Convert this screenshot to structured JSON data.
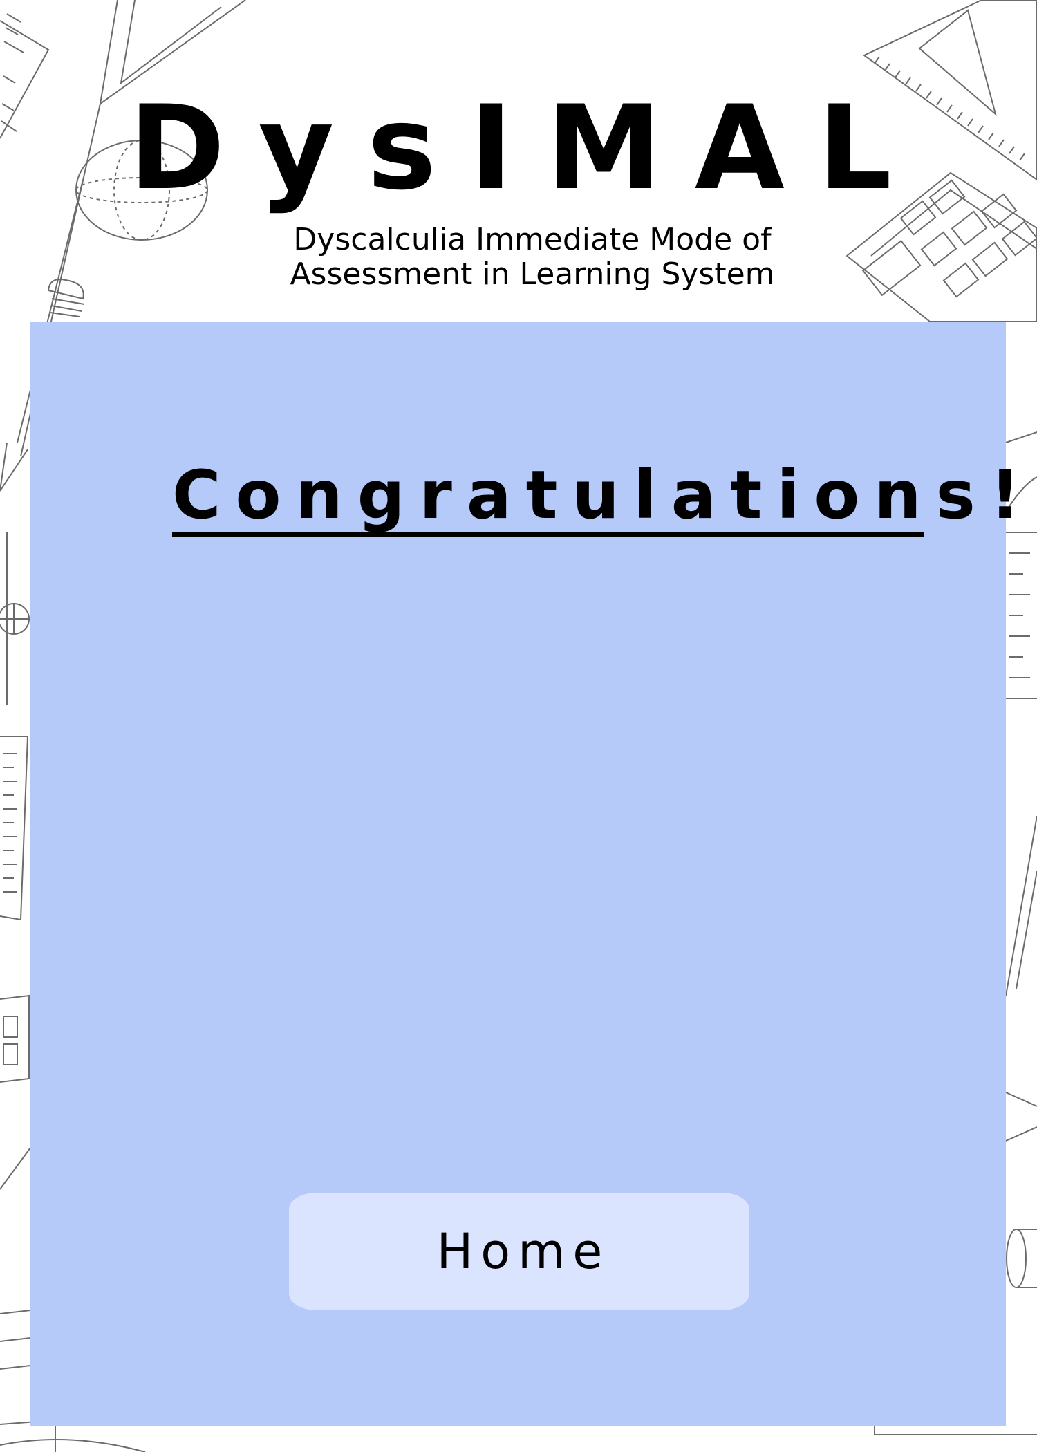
{
  "header": {
    "title": "DysIMAL",
    "subtitle_line1": "Dyscalculia Immediate Mode of",
    "subtitle_line2": "Assessment in Learning System"
  },
  "card": {
    "heading": "Congratulations!",
    "home_button_label": "Home"
  },
  "colors": {
    "card_background": "#b5caf9",
    "button_background": "#dae4fe",
    "doodle_stroke": "#6b6b6b"
  },
  "background": {
    "decoration_icons": [
      "triangle-ruler-icon",
      "globe-icon",
      "pencil-icon",
      "calculator-icon",
      "ruler-icon",
      "set-square-icon",
      "compass-icon",
      "cylinder-icon"
    ]
  }
}
